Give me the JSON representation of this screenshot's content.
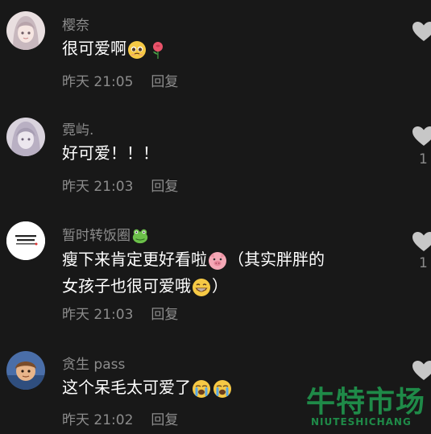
{
  "comments": [
    {
      "username": "樱奈",
      "text": "很可爱啊",
      "time": "昨天 21:05",
      "reply_label": "回复",
      "like_count": "",
      "emojis": [
        "pleading-face-emoji",
        "rose-emoji"
      ],
      "avatar": "anime-girl-avatar"
    },
    {
      "username": "霓屿.",
      "text": "好可爱！！！",
      "time": "昨天 21:03",
      "reply_label": "回复",
      "like_count": "1",
      "emojis": [],
      "avatar": "anime-girl-sketch-avatar"
    },
    {
      "username": "暂时转饭圈",
      "username_emoji": "frog-emoji",
      "text_line1_a": "瘦下来肯定更好看啦",
      "text_line1_b": "（其实胖胖的",
      "text_line2_a": "女孩子也很可爱哦",
      "text_line2_b": "）",
      "time": "昨天 21:03",
      "reply_label": "回复",
      "like_count": "1",
      "emojis": [
        "pig-face-emoji",
        "grinning-face-emoji"
      ],
      "avatar": "text-logo-avatar"
    },
    {
      "username": "贪生 pass",
      "text": "这个呆毛太可爱了",
      "time": "昨天 21:02",
      "reply_label": "回复",
      "like_count": "",
      "emojis": [
        "crying-face-emoji",
        "crying-face-emoji"
      ],
      "avatar": "cartoon-character-avatar"
    }
  ],
  "watermark": {
    "cn": "牛特市场",
    "en": "NIUTESHICHANG"
  },
  "colors": {
    "background": "#181818",
    "secondary_text": "#8c8c8c",
    "primary_text": "#ffffff",
    "heart": "#c7c7c7",
    "watermark": "#1f8a48"
  }
}
